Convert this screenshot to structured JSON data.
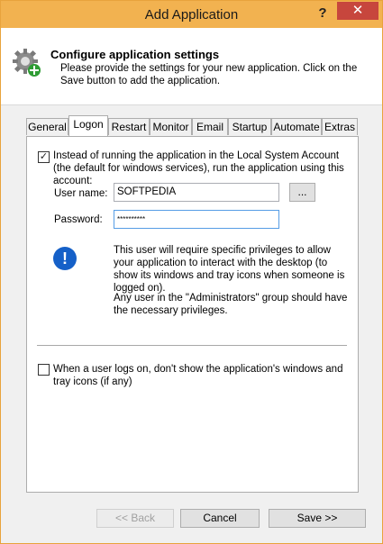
{
  "window": {
    "title": "Add Application",
    "help": "?",
    "close": "✕"
  },
  "header": {
    "icon": "gear-add-icon",
    "title": "Configure application settings",
    "description": "Please provide the settings for your new application. Click on the Save button to add the application."
  },
  "tabs": [
    {
      "label": "General",
      "active": false
    },
    {
      "label": "Logon",
      "active": true
    },
    {
      "label": "Restart",
      "active": false
    },
    {
      "label": "Monitor",
      "active": false
    },
    {
      "label": "Email",
      "active": false
    },
    {
      "label": "Startup",
      "active": false
    },
    {
      "label": "Automate",
      "active": false
    },
    {
      "label": "Extras",
      "active": false
    }
  ],
  "logon": {
    "run_as_checkbox": {
      "checked": true,
      "label": "Instead of running the application in the Local System Account (the default for windows services), run the application using this account:"
    },
    "username": {
      "label": "User name:",
      "value": "SOFTPEDIA",
      "browse": "..."
    },
    "password": {
      "label": "Password:",
      "value": "**********"
    },
    "info_icon": "info-icon",
    "info_text1": "This user will require specific privileges to allow your application to interact with the desktop (to show its windows and tray icons when someone is logged on).",
    "info_text2": "Any user in the \"Administrators\" group should have the necessary privileges.",
    "hide_checkbox": {
      "checked": false,
      "label": "When a user logs on, don't show the application's windows and tray icons (if any)"
    }
  },
  "footer": {
    "back": "<< Back",
    "cancel": "Cancel",
    "save": "Save >>"
  }
}
